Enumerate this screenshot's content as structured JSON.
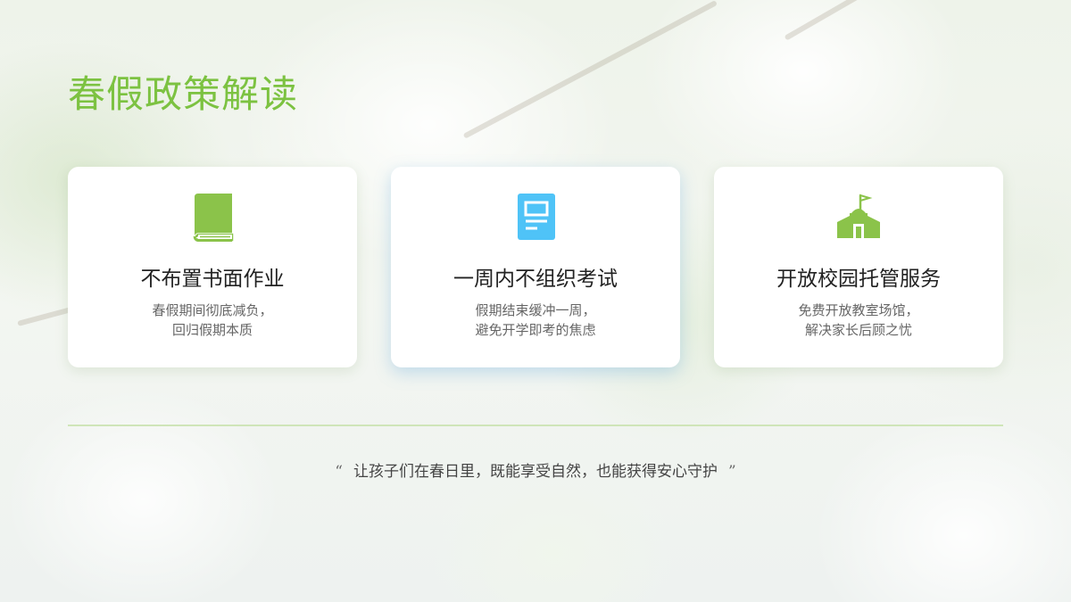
{
  "title": "春假政策解读",
  "cards": [
    {
      "icon": "book-icon",
      "heading": "不布置书面作业",
      "lines": [
        "春假期间彻底减负，",
        "回归假期本质"
      ]
    },
    {
      "icon": "document-icon",
      "heading": "一周内不组织考试",
      "lines": [
        "假期结束缓冲一周，",
        "避免开学即考的焦虑"
      ]
    },
    {
      "icon": "school-icon",
      "heading": "开放校园托管服务",
      "lines": [
        "免费开放教室场馆，",
        "解决家长后顾之忧"
      ]
    }
  ],
  "quote": {
    "open": "“",
    "text": "让孩子们在春日里，既能享受自然，也能获得安心守护",
    "close": "”"
  },
  "colors": {
    "accent": "#7cc241",
    "book": "#8bc34a",
    "doc": "#4fc3f7",
    "school": "#8bc34a"
  }
}
